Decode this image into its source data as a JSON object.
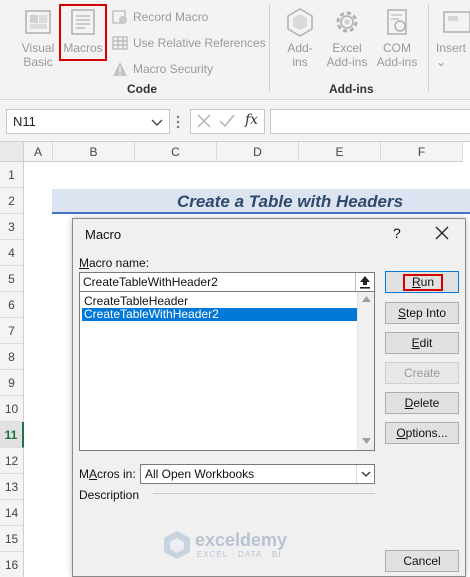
{
  "ribbon": {
    "visual_basic": {
      "line1": "Visual",
      "line2": "Basic"
    },
    "macros": "Macros",
    "record_macro": "Record Macro",
    "use_relative_references": "Use Relative References",
    "macro_security": "Macro Security",
    "group_code": "Code",
    "addins": {
      "line1": "Add-",
      "line2": "ins"
    },
    "excel_addins": {
      "line1": "Excel",
      "line2": "Add-ins"
    },
    "com_addins": {
      "line1": "COM",
      "line2": "Add-ins"
    },
    "group_addins": "Add-ins",
    "insert": {
      "line1": "Insert",
      "line2": "⌄"
    },
    "highlight_color": "#d40000"
  },
  "formula_bar": {
    "name_box": "N11",
    "fx_label": "fx",
    "formula": ""
  },
  "grid": {
    "columns": [
      "A",
      "B",
      "C",
      "D",
      "E",
      "F"
    ],
    "rows": [
      "1",
      "2",
      "3",
      "4",
      "5",
      "6",
      "7",
      "8",
      "9",
      "10",
      "11",
      "12",
      "13",
      "14",
      "15",
      "16"
    ],
    "selected_row": "11",
    "title": "Create a Table with Headers"
  },
  "dialog": {
    "title": "Macro",
    "help": "?",
    "macro_name_label": {
      "mnemonic": "M",
      "rest": "acro name:"
    },
    "macro_name_value": "CreateTableWithHeader2",
    "macros": [
      "CreateTableHeader",
      "CreateTableWithHeader2"
    ],
    "selected_index": 1,
    "buttons": {
      "run": {
        "mnemonic": "R",
        "rest": "un"
      },
      "step_into": {
        "mnemonic": "S",
        "rest": "tep Into"
      },
      "edit": {
        "mnemonic": "E",
        "rest": "dit"
      },
      "create": "Create",
      "delete": {
        "mnemonic": "D",
        "rest": "elete"
      },
      "options": {
        "mnemonic": "O",
        "rest": "ptions..."
      },
      "cancel": "Cancel"
    },
    "macros_in_label": {
      "mnemonic": "A",
      "prefix": "M",
      "rest": "cros in:"
    },
    "macros_in_value": "All Open Workbooks",
    "description_label": "Description"
  },
  "watermark": {
    "name": "exceldemy",
    "tagline": "EXCEL · DATA · BI"
  }
}
